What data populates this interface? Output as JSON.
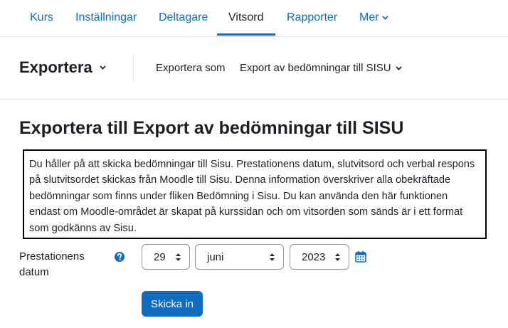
{
  "nav": {
    "items": [
      {
        "label": "Kurs"
      },
      {
        "label": "Inställningar"
      },
      {
        "label": "Deltagare"
      },
      {
        "label": "Vitsord"
      },
      {
        "label": "Rapporter"
      },
      {
        "label": "Mer"
      }
    ],
    "active": "Vitsord"
  },
  "tertiary": {
    "title": "Exportera",
    "export_as_label": "Exportera som",
    "export_as_value": "Export av bedömningar till SISU"
  },
  "page": {
    "heading": "Exportera till Export av bedömningar till SISU",
    "info": "Du håller på att skicka bedömningar till Sisu. Prestationens datum, slutvitsord och verbal respons på slutvitsordet skickas från Moodle till Sisu. Denna information överskriver alla obekräftade bedömningar som finns under fliken Bedömning i Sisu. Du kan använda den här funktionen endast om Moodle-området är skapat på kurssidan och om vitsorden som sänds är i ett format som godkänns av Sisu."
  },
  "form": {
    "date_label": "Prestationens datum",
    "day": "29",
    "month": "juni",
    "year": "2023",
    "submit_label": "Skicka in"
  },
  "colors": {
    "link": "#0f6cbf",
    "primary_button": "#0f6cbf",
    "border": "#dee2e6",
    "text": "#1d2125"
  },
  "icons": {
    "help": "question-circle-icon",
    "calendar": "calendar-icon",
    "dropdown": "chevron-down-icon",
    "select_arrows": "sort-arrows-icon"
  }
}
